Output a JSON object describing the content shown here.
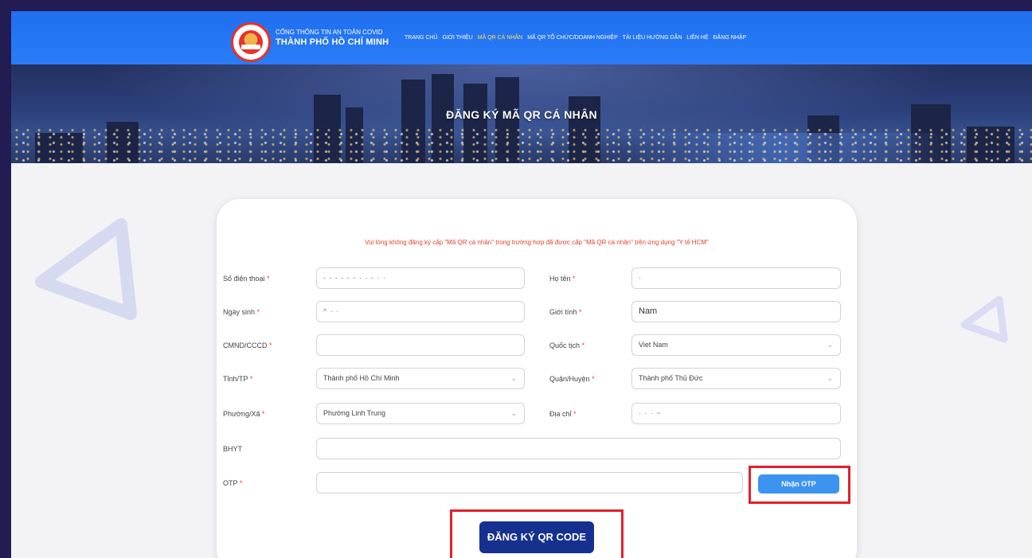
{
  "header": {
    "brand_line1": "CỔNG THÔNG TIN AN TOÀN COVID",
    "brand_line2": "THÀNH PHỐ HỒ CHÍ MINH",
    "nav": [
      {
        "label": "TRANG CHỦ",
        "active": false
      },
      {
        "label": "GIỚI THIỆU",
        "active": false
      },
      {
        "label": "MÃ QR CÁ NHÂN",
        "active": true
      },
      {
        "label": "MÃ QR TỔ CHỨC/DOANH NGHIỆP",
        "active": false
      },
      {
        "label": "TÀI LIỆU HƯỚNG DẪN",
        "active": false
      },
      {
        "label": "LIÊN HỆ",
        "active": false
      },
      {
        "label": "ĐĂNG NHẬP",
        "active": false
      }
    ],
    "active_color": "#ffe34d"
  },
  "banner": {
    "title": "ĐĂNG KÝ MÃ QR CÁ NHÂN"
  },
  "form": {
    "warning": "Vui lòng không đăng ký cấp \"Mã QR cá nhân\" trong trường hợp đã được cấp \"Mã QR cá nhân\" trên ứng dụng \"Y tế HCM\"",
    "required_mark": "*",
    "phone": {
      "label": "Số điện thoại",
      "value": "- - - - - - · · - · ·"
    },
    "name": {
      "label": "Họ tên",
      "value": "·"
    },
    "dob": {
      "label": "Ngày sinh",
      "value": "^ · ·"
    },
    "gender": {
      "label": "Giới tính",
      "value": "Nam"
    },
    "id_card": {
      "label": "CMND/CCCD",
      "value": ""
    },
    "nationality": {
      "label": "Quốc tịch",
      "value": "Viet Nam"
    },
    "province": {
      "label": "Tỉnh/TP",
      "value": "Thành phố Hồ Chí Minh"
    },
    "district": {
      "label": "Quận/Huyện",
      "value": "Thành phố Thủ Đức"
    },
    "ward": {
      "label": "Phường/Xã",
      "value": "Phường Linh Trung"
    },
    "address": {
      "label": "Địa chỉ",
      "value": "·  ·  ·  ~"
    },
    "insurance": {
      "label": "BHYT",
      "value": ""
    },
    "otp": {
      "label": "OTP",
      "value": ""
    },
    "otp_button": "Nhận OTP",
    "submit_button": "ĐĂNG KÝ QR CODE"
  },
  "colors": {
    "header_blue": "#1f6ff0",
    "warning_red": "#e53f2b",
    "submit_navy": "#15308f",
    "otp_blue": "#3d94f0",
    "highlight_red": "#e2202c"
  }
}
